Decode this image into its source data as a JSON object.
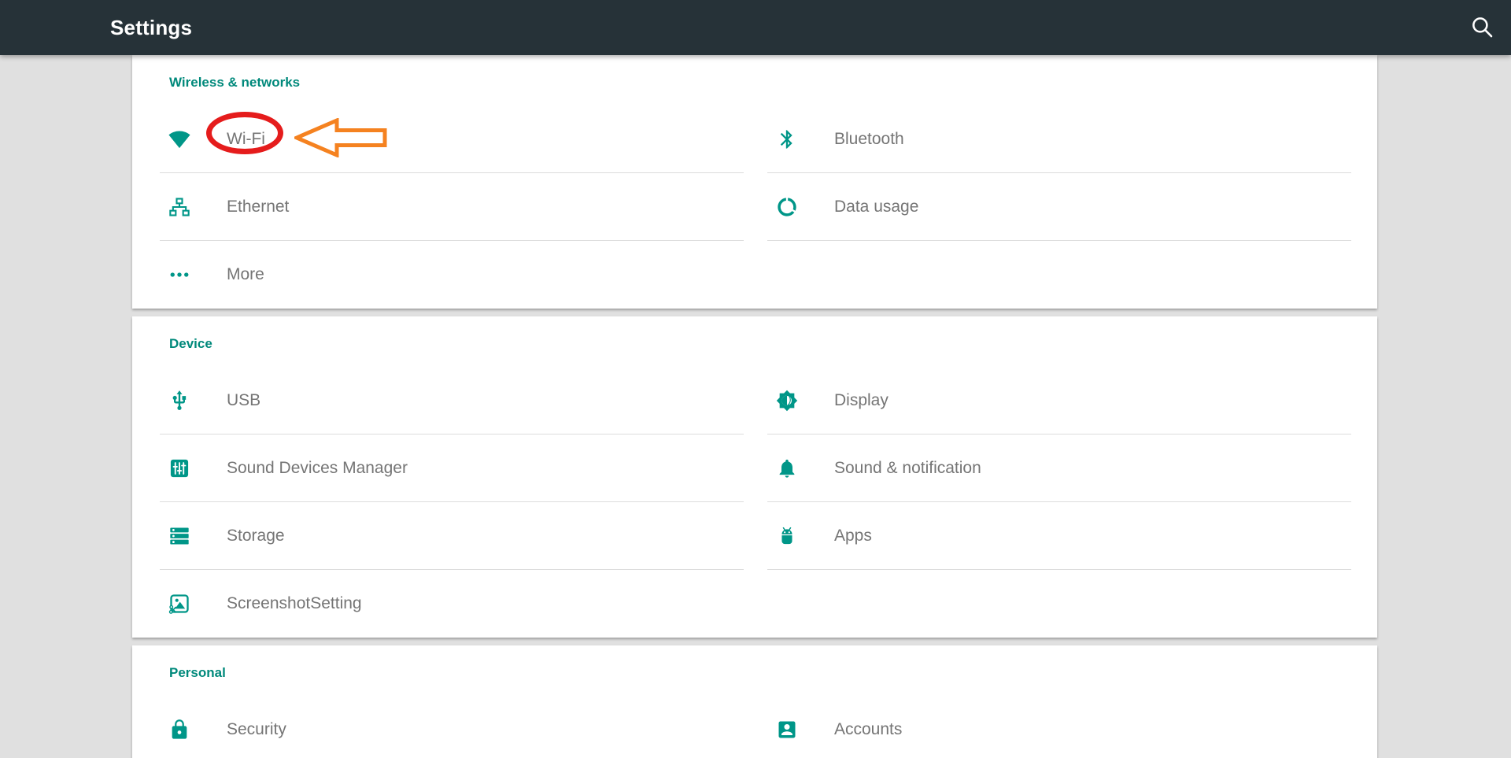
{
  "app_bar": {
    "title": "Settings",
    "search_icon": "search-icon"
  },
  "colors": {
    "app_bar_bg": "#263238",
    "accent_teal": "#009688",
    "section_header_teal": "#00897b",
    "label_gray": "#757575",
    "divider": "#dcdcdc",
    "page_bg": "#e0e0e0",
    "annotation_circle_red": "#e51c1c",
    "annotation_arrow_orange": "#f58220"
  },
  "annotation": {
    "type": "ellipse-and-left-arrow",
    "target_item": "Wi-Fi",
    "circle_color": "#e51c1c",
    "arrow_color": "#f58220"
  },
  "sections": [
    {
      "header": "Wireless & networks",
      "left": [
        {
          "label": "Wi-Fi",
          "icon": "wifi-icon",
          "divider": true
        },
        {
          "label": "Ethernet",
          "icon": "ethernet-icon",
          "divider": true
        },
        {
          "label": "More",
          "icon": "more-icon",
          "divider": false
        }
      ],
      "right": [
        {
          "label": "Bluetooth",
          "icon": "bluetooth-icon",
          "divider": true
        },
        {
          "label": "Data usage",
          "icon": "data-usage-icon",
          "divider": true
        }
      ]
    },
    {
      "header": "Device",
      "left": [
        {
          "label": "USB",
          "icon": "usb-icon",
          "divider": true
        },
        {
          "label": "Sound Devices Manager",
          "icon": "sound-devices-manager-icon",
          "divider": true
        },
        {
          "label": "Storage",
          "icon": "storage-icon",
          "divider": true
        },
        {
          "label": "ScreenshotSetting",
          "icon": "screenshot-setting-icon",
          "divider": false
        }
      ],
      "right": [
        {
          "label": "Display",
          "icon": "display-icon",
          "divider": true
        },
        {
          "label": "Sound & notification",
          "icon": "sound-notification-icon",
          "divider": true
        },
        {
          "label": "Apps",
          "icon": "apps-icon",
          "divider": true
        }
      ]
    },
    {
      "header": "Personal",
      "left": [
        {
          "label": "Security",
          "icon": "security-icon",
          "divider": false
        }
      ],
      "right": [
        {
          "label": "Accounts",
          "icon": "accounts-icon",
          "divider": false
        }
      ]
    }
  ]
}
